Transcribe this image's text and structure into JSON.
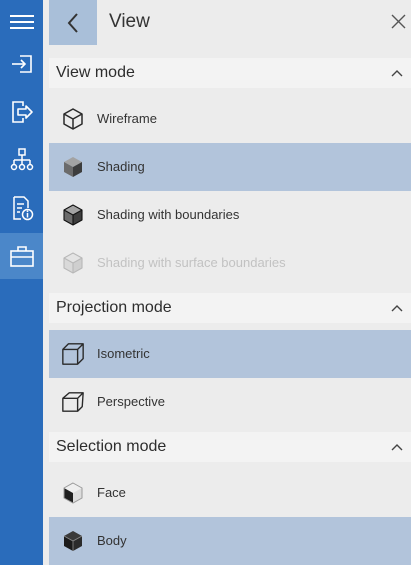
{
  "rail": {
    "items": [
      {
        "name": "menu",
        "icon": "hamburger-menu-icon",
        "active": false
      },
      {
        "name": "import",
        "icon": "import-icon",
        "active": false
      },
      {
        "name": "export",
        "icon": "export-icon",
        "active": false
      },
      {
        "name": "structure",
        "icon": "hierarchy-tree-icon",
        "active": false
      },
      {
        "name": "properties",
        "icon": "document-info-icon",
        "active": false
      },
      {
        "name": "toolbox",
        "icon": "briefcase-icon",
        "active": true
      }
    ],
    "colors": {
      "background": "#2a6cbb",
      "active": "#4b87c9",
      "icon": "#ffffff"
    }
  },
  "header": {
    "title": "View",
    "back_icon": "chevron-left-icon",
    "close_icon": "close-icon",
    "colors": {
      "back_bg": "#a9bfd9"
    }
  },
  "sections": [
    {
      "title": "View mode",
      "items": [
        {
          "label": "Wireframe",
          "icon": "wireframe-cube-icon",
          "selected": false,
          "disabled": false
        },
        {
          "label": "Shading",
          "icon": "shaded-cube-icon",
          "selected": true,
          "disabled": false
        },
        {
          "label": "Shading with boundaries",
          "icon": "shaded-boundaries-cube-icon",
          "selected": false,
          "disabled": false
        },
        {
          "label": "Shading with surface boundaries",
          "icon": "surface-boundaries-cube-icon",
          "selected": false,
          "disabled": true
        }
      ]
    },
    {
      "title": "Projection mode",
      "items": [
        {
          "label": "Isometric",
          "icon": "isometric-cube-icon",
          "selected": true,
          "disabled": false
        },
        {
          "label": "Perspective",
          "icon": "perspective-cube-icon",
          "selected": false,
          "disabled": false
        }
      ]
    },
    {
      "title": "Selection mode",
      "items": [
        {
          "label": "Face",
          "icon": "face-select-cube-icon",
          "selected": false,
          "disabled": false
        },
        {
          "label": "Body",
          "icon": "body-select-cube-icon",
          "selected": true,
          "disabled": false
        }
      ]
    }
  ],
  "colors": {
    "selected_row": "#b2c4db",
    "section_header_bg": "#f3f3f3",
    "panel_bg": "#ececec"
  }
}
